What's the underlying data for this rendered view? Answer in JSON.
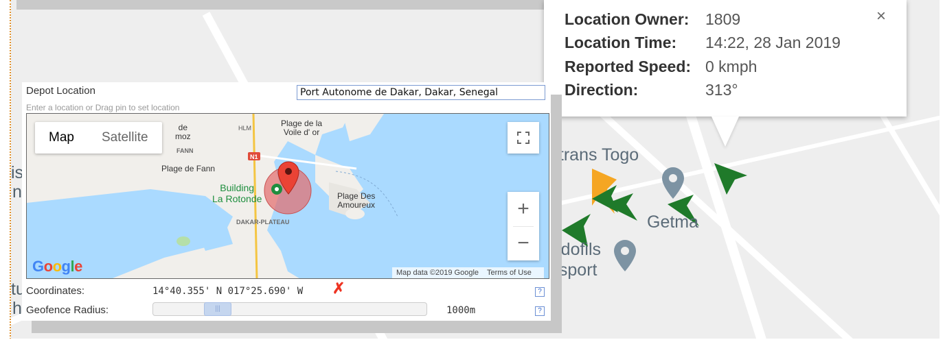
{
  "info_window": {
    "rows": [
      {
        "key": "Location Owner:",
        "value": "1809"
      },
      {
        "key": "Location Time:",
        "value": "14:22, 28 Jan 2019"
      },
      {
        "key": "Reported Speed:",
        "value": "0 kmph"
      },
      {
        "key": "Direction:",
        "value": "313°"
      }
    ],
    "close_glyph": "×"
  },
  "bg_map": {
    "labels": [
      "otrans Togo",
      "Getma",
      "Edofils",
      "nsport"
    ],
    "edge_letters": [
      "is",
      "n",
      "tu",
      "h"
    ]
  },
  "depot": {
    "title": "Depot Location",
    "hint": "Enter a location or Drag pin to set location",
    "location_value": "Port Autonome de Dakar, Dakar, Senegal",
    "map": {
      "type_buttons": [
        "Map",
        "Satellite"
      ],
      "active_type": "Map",
      "labels": {
        "plage_voile": "Plage de la\nVoile d' or",
        "hlm": "HLM",
        "de_mmoz": "de\nmoz",
        "fann": "FANN",
        "n1": "N1",
        "plage_fann": "Plage de Fann",
        "building": "Building\nLa Rotonde",
        "plage_amoureux": "Plage Des\nAmoureux",
        "dakar_plateau": "DAKAR-PLATEAU"
      },
      "zoom_in": "+",
      "zoom_out": "−",
      "google": "Google",
      "attribution_data": "Map data ©2019 Google",
      "attribution_terms": "Terms of Use"
    },
    "coordinates_label": "Coordinates:",
    "coordinates_value": "14°40.355' N 017°25.690' W",
    "clear_glyph": "✗",
    "radius_label": "Geofence Radius:",
    "radius_value": "1000m",
    "radius_fraction": 0.2,
    "help_glyph": "?"
  },
  "colors": {
    "water": "#aadaff",
    "marker_green": "#1f7a2a",
    "marker_orange": "#f5a623",
    "pin_red": "#ea4335",
    "geofence": "#e36b6b"
  }
}
